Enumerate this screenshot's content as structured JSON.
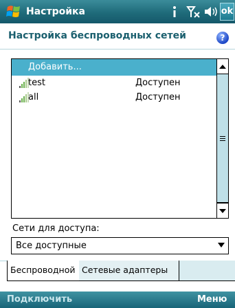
{
  "titlebar": {
    "title": "Настройка",
    "ok_label": "ok",
    "icons": [
      "windows-start-icon",
      "info-icon",
      "signal-off-icon",
      "volume-icon"
    ]
  },
  "header": {
    "title": "Настройка беспроводных сетей",
    "help_label": "?"
  },
  "network_list": {
    "add_label": "Добавить...",
    "items": [
      {
        "name": "test",
        "status": "Доступен"
      },
      {
        "name": "all",
        "status": "Доступен"
      }
    ]
  },
  "access": {
    "label": "Сети для доступа:",
    "selected": "Все доступные"
  },
  "tabs": [
    {
      "label": "Беспроводной",
      "active": true
    },
    {
      "label": "Сетевые адаптеры",
      "active": false
    }
  ],
  "softkeys": {
    "left": "Подключить",
    "right": "Меню"
  },
  "colors": {
    "titlebar": "#1f6b7a",
    "selection": "#4ab0cc",
    "header_text": "#1a5f6e",
    "scroll_thumb": "#bfe0e8"
  }
}
